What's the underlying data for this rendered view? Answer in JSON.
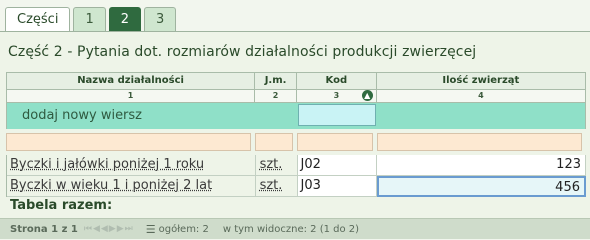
{
  "tabs": [
    "Części",
    "1",
    "2",
    "3"
  ],
  "title": "Część 2 - Pytania dot. rozmiarów działalności produkcji zwierzęcej",
  "columns": {
    "nazwa": "Nazwa działalności",
    "jm": "J.m.",
    "kod": "Kod",
    "ilosc": "Ilość zwierząt"
  },
  "column_numbers": {
    "c1": "1",
    "c2": "2",
    "c3": "3",
    "c4": "4"
  },
  "add_row_label": "dodaj nowy wiersz",
  "rows": [
    {
      "nazwa": "Byczki i jałówki poniżej 1 roku",
      "jm": "szt.",
      "kod": "J02",
      "ilosc": "123"
    },
    {
      "nazwa": "Byczki w wieku 1 i poniżej 2 lat",
      "jm": "szt.",
      "kod": "J03",
      "ilosc": "456"
    }
  ],
  "total_label": "Tabela razem:",
  "pager": {
    "page": "Strona 1 z 1",
    "total": "ogółem: 2",
    "visible": "w tym widoczne: 2 (1 do 2)"
  },
  "colors": {
    "accent": "#2f6a3f",
    "add_row": "#8fe0c8",
    "filter": "#fde9d2"
  }
}
